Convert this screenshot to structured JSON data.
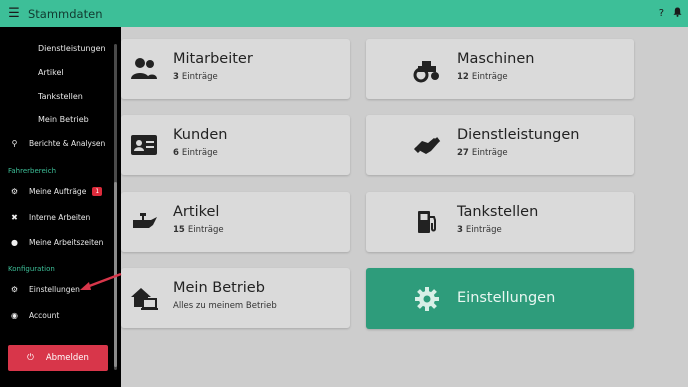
{
  "topbar": {
    "title": "Stammdaten",
    "help": "?",
    "menu_icon": "menu-icon",
    "bell_icon": "bell-icon"
  },
  "sidebar": {
    "sub_items": [
      "Dienstleistungen",
      "Artikel",
      "Tankstellen",
      "Mein Betrieb"
    ],
    "berichte": "Berichte & Analysen",
    "section_fahrer": "Fahrerbereich",
    "auftraege": "Meine Aufträge",
    "auftraege_badge": "1",
    "interne": "Interne Arbeiten",
    "arbeitszeiten": "Meine Arbeitszeiten",
    "section_konfig": "Konfiguration",
    "einstellungen": "Einstellungen",
    "account": "Account",
    "logout": "Abmelden"
  },
  "cards": {
    "mitarbeiter": {
      "title": "Mitarbeiter",
      "count": "3",
      "suffix": "Einträge"
    },
    "maschinen": {
      "title": "Maschinen",
      "count": "12",
      "suffix": "Einträge"
    },
    "kunden": {
      "title": "Kunden",
      "count": "6",
      "suffix": "Einträge"
    },
    "dienstleistungen": {
      "title": "Dienstleistungen",
      "count": "27",
      "suffix": "Einträge"
    },
    "artikel": {
      "title": "Artikel",
      "count": "15",
      "suffix": "Einträge"
    },
    "tankstellen": {
      "title": "Tankstellen",
      "count": "3",
      "suffix": "Einträge"
    },
    "betrieb": {
      "title": "Mein Betrieb",
      "subtitle": "Alles zu meinem Betrieb"
    },
    "einstellungen": {
      "title": "Einstellungen"
    }
  },
  "colors": {
    "accent": "#3dbf98",
    "active_card": "#2e9c7b",
    "logout": "#d8364a",
    "badge": "#dc2b3b"
  }
}
